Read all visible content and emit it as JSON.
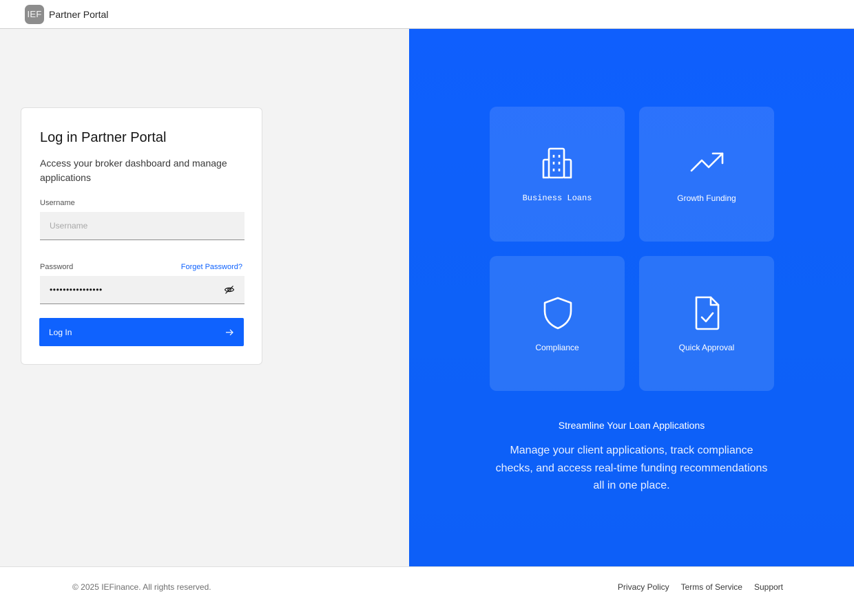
{
  "header": {
    "logo_text": "IEF",
    "brand": "Partner Portal"
  },
  "login": {
    "title": "Log in Partner Portal",
    "subtitle": "Access your broker dashboard and manage applications",
    "username_label": "Username",
    "username_placeholder": "Username",
    "username_value": "",
    "password_label": "Password",
    "forgot_link": "Forget Password?",
    "password_masked": "••••••••••••••••",
    "submit_label": "Log In"
  },
  "features": {
    "tiles": [
      {
        "label": "Business Loans",
        "icon": "building-icon"
      },
      {
        "label": "Growth Funding",
        "icon": "trending-up-icon"
      },
      {
        "label": "Compliance",
        "icon": "shield-icon"
      },
      {
        "label": "Quick Approval",
        "icon": "document-check-icon"
      }
    ],
    "headline": "Streamline Your Loan Applications",
    "body": "Manage your client applications, track compliance checks, and access real-time funding recommendations all in one place."
  },
  "footer": {
    "copyright": "© 2025 IEFinance. All rights reserved.",
    "links": [
      "Privacy Policy",
      "Terms of Service",
      "Support"
    ]
  },
  "colors": {
    "primary": "#0f62fe",
    "panel_blue": "#0f5ffd",
    "left_bg": "#f3f3f3"
  }
}
